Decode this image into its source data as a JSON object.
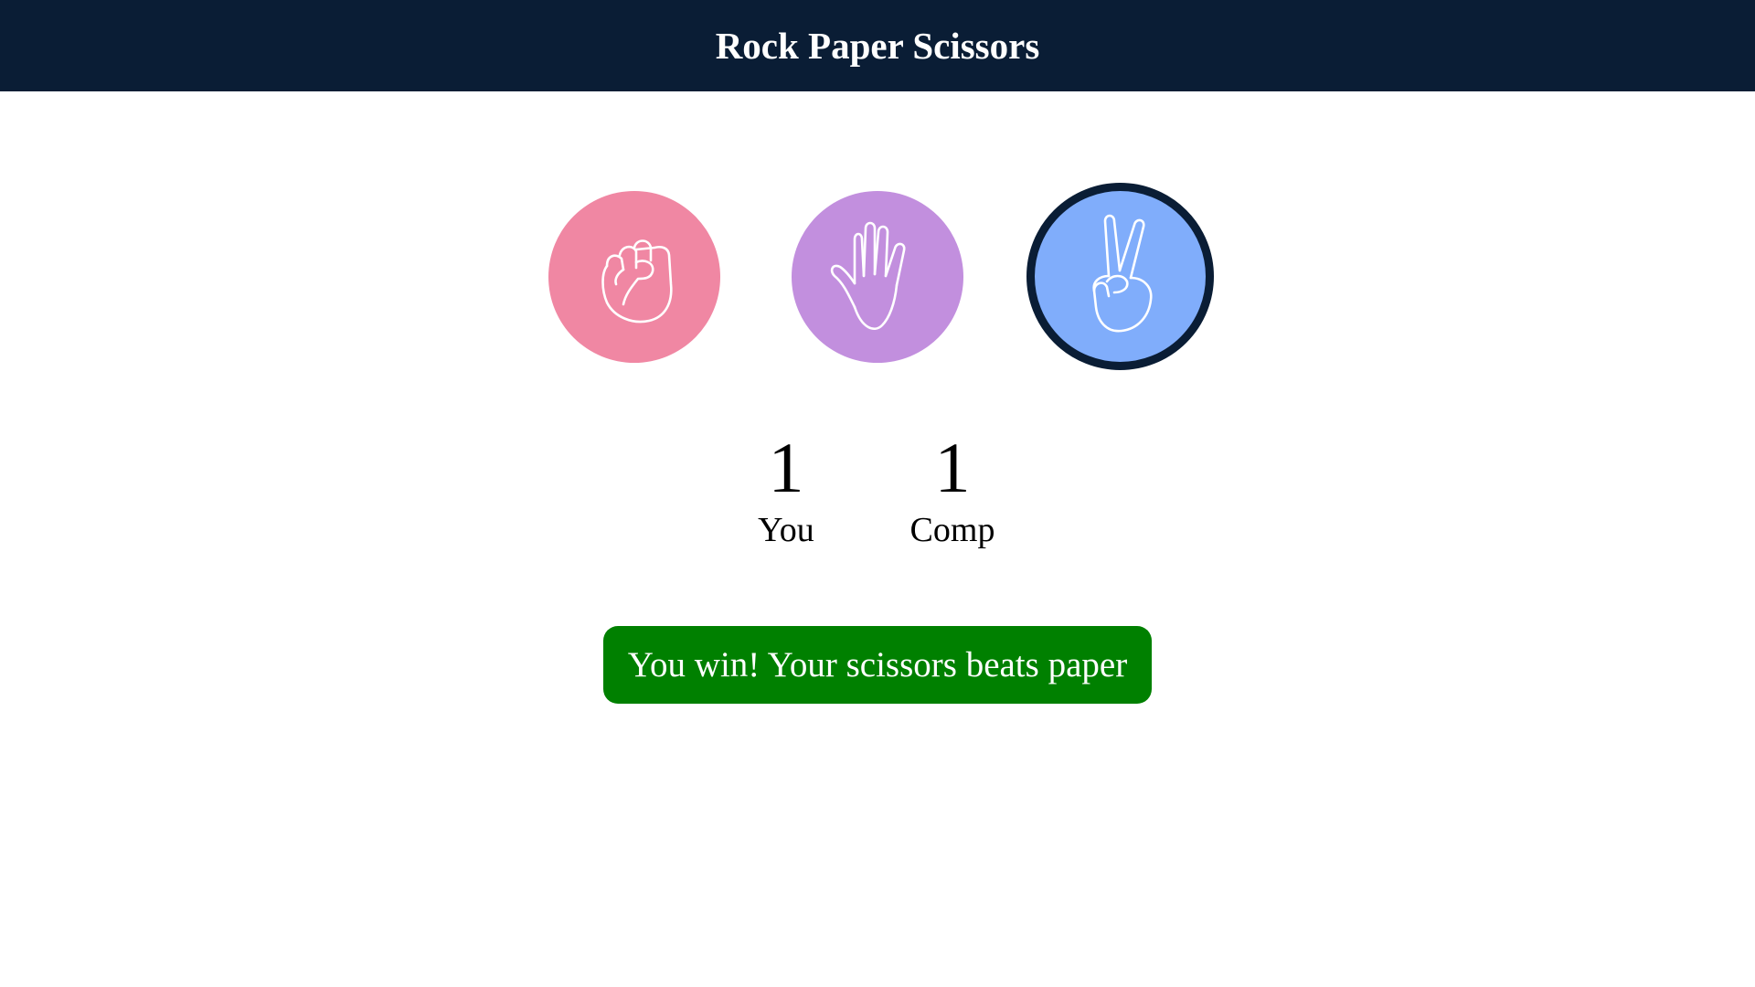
{
  "header": {
    "title": "Rock Paper Scissors"
  },
  "choices": [
    {
      "name": "rock",
      "icon": "fist-icon",
      "color": "#f087a3",
      "selected": false
    },
    {
      "name": "paper",
      "icon": "open-hand-icon",
      "color": "#c28fde",
      "selected": false
    },
    {
      "name": "scissors",
      "icon": "peace-hand-icon",
      "color": "#80adfb",
      "selected": true
    }
  ],
  "score": {
    "you": {
      "value": "1",
      "label": "You"
    },
    "comp": {
      "value": "1",
      "label": "Comp"
    }
  },
  "result": {
    "message": "You win! Your scissors beats paper",
    "color": "#008000"
  },
  "colors": {
    "header_bg": "#0a1d35",
    "selected_border": "#0a1d35"
  }
}
